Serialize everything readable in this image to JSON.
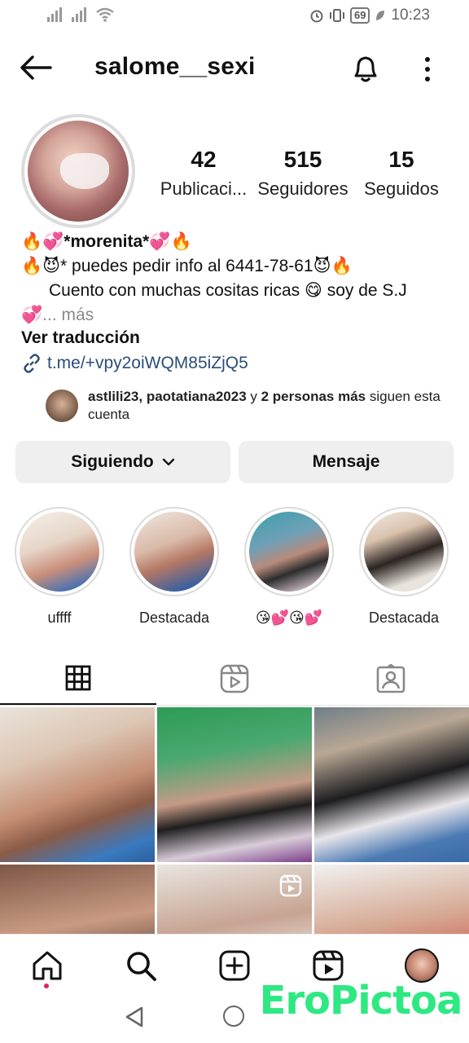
{
  "status_bar": {
    "battery": "69",
    "time": "10:23"
  },
  "header": {
    "username": "salome__sexi"
  },
  "profile": {
    "stats": [
      {
        "value": "42",
        "label": "Publicaci..."
      },
      {
        "value": "515",
        "label": "Seguidores"
      },
      {
        "value": "15",
        "label": "Seguidos"
      }
    ],
    "bio": {
      "name": "🔥💞*morenita*💞🔥",
      "line1": "🔥😈* puedes pedir info al 6441-78-61😈🔥",
      "line2": "Cuento con muchas cositas ricas 😋 soy de S.J",
      "line3_emoji": "💞",
      "more": "... más"
    },
    "translate": "Ver traducción",
    "link": "t.me/+vpy2oiWQM85iZjQ5",
    "followed_by": {
      "users": "astlili23, paotatiana2023",
      "conj": " y ",
      "others": "2 personas más",
      "suffix": " siguen esta cuenta"
    }
  },
  "actions": {
    "following": "Siguiendo",
    "message": "Mensaje"
  },
  "highlights": [
    {
      "label": "uffff"
    },
    {
      "label": "Destacada"
    },
    {
      "label": "😘💕😘💕"
    },
    {
      "label": "Destacada"
    }
  ],
  "tabs": [
    {
      "icon": "grid-icon",
      "active": true
    },
    {
      "icon": "reels-icon",
      "active": false
    },
    {
      "icon": "tagged-icon",
      "active": false
    }
  ],
  "bottom_nav": [
    "home-icon",
    "search-icon",
    "create-icon",
    "reels-icon",
    "profile-avatar"
  ],
  "watermark": "EroPictoa",
  "colors": {
    "link": "#2d4d7a",
    "button_bg": "#efefef",
    "watermark": "#2ee882",
    "notification_dot": "#e0245e"
  }
}
